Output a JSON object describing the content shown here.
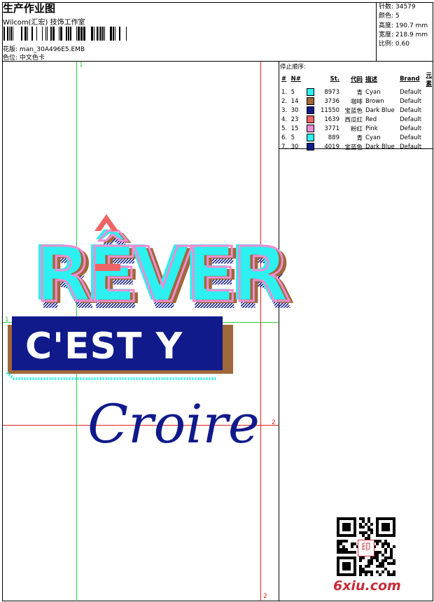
{
  "header": {
    "title": "生产作业图",
    "subtitle": "Wilcom(汇宏) 技饰工作室",
    "pattern_label": "花版:",
    "pattern_value": "man_30A496E5.EMB",
    "color_label": "色位:",
    "color_value": "中文色卡"
  },
  "stats": {
    "stitches_label": "针数:",
    "stitches": "34579",
    "colors_label": "颜色:",
    "colors": "5",
    "height_label": "高度:",
    "height": "190.7 mm",
    "width_label": "宽度:",
    "width": "218.9 mm",
    "scale_label": "比例:",
    "scale": "0.60"
  },
  "stop_sequence": {
    "title": "停止顺序:",
    "headers": [
      "#",
      "N#",
      "",
      "St.",
      "代码",
      "描述",
      "Brand",
      "元素"
    ],
    "rows": [
      {
        "idx": "1.",
        "n": "5",
        "color": "#2df0f0",
        "st": "8973",
        "code": "青",
        "desc": "Cyan",
        "brand": "Default"
      },
      {
        "idx": "2.",
        "n": "14",
        "color": "#a0683a",
        "st": "3736",
        "code": "咖啡",
        "desc": "Brown",
        "brand": "Default"
      },
      {
        "idx": "3.",
        "n": "30",
        "color": "#101a8a",
        "st": "11550",
        "code": "宝蓝色",
        "desc": "Dark Blue",
        "brand": "Default"
      },
      {
        "idx": "4.",
        "n": "23",
        "color": "#f06464",
        "st": "1639",
        "code": "西瓜红",
        "desc": "Red",
        "brand": "Default"
      },
      {
        "idx": "5.",
        "n": "15",
        "color": "#f08cd2",
        "st": "3771",
        "code": "粉红",
        "desc": "Pink",
        "brand": "Default"
      },
      {
        "idx": "6.",
        "n": "5",
        "color": "#2df0f0",
        "st": "889",
        "code": "青",
        "desc": "Cyan",
        "brand": "Default"
      },
      {
        "idx": "7.",
        "n": "30",
        "color": "#101a8a",
        "st": "4019",
        "code": "宝蓝色",
        "desc": "Dark Blue",
        "brand": "Default"
      }
    ]
  },
  "design": {
    "line1": "RÊVER",
    "line2": "C'EST Y",
    "line3": "Croire"
  },
  "guides": {
    "green_v": "1",
    "green_h": "1",
    "red_h": "2",
    "red_v": "2"
  },
  "watermark": {
    "stamp": "印",
    "site": "6xiu.com"
  }
}
